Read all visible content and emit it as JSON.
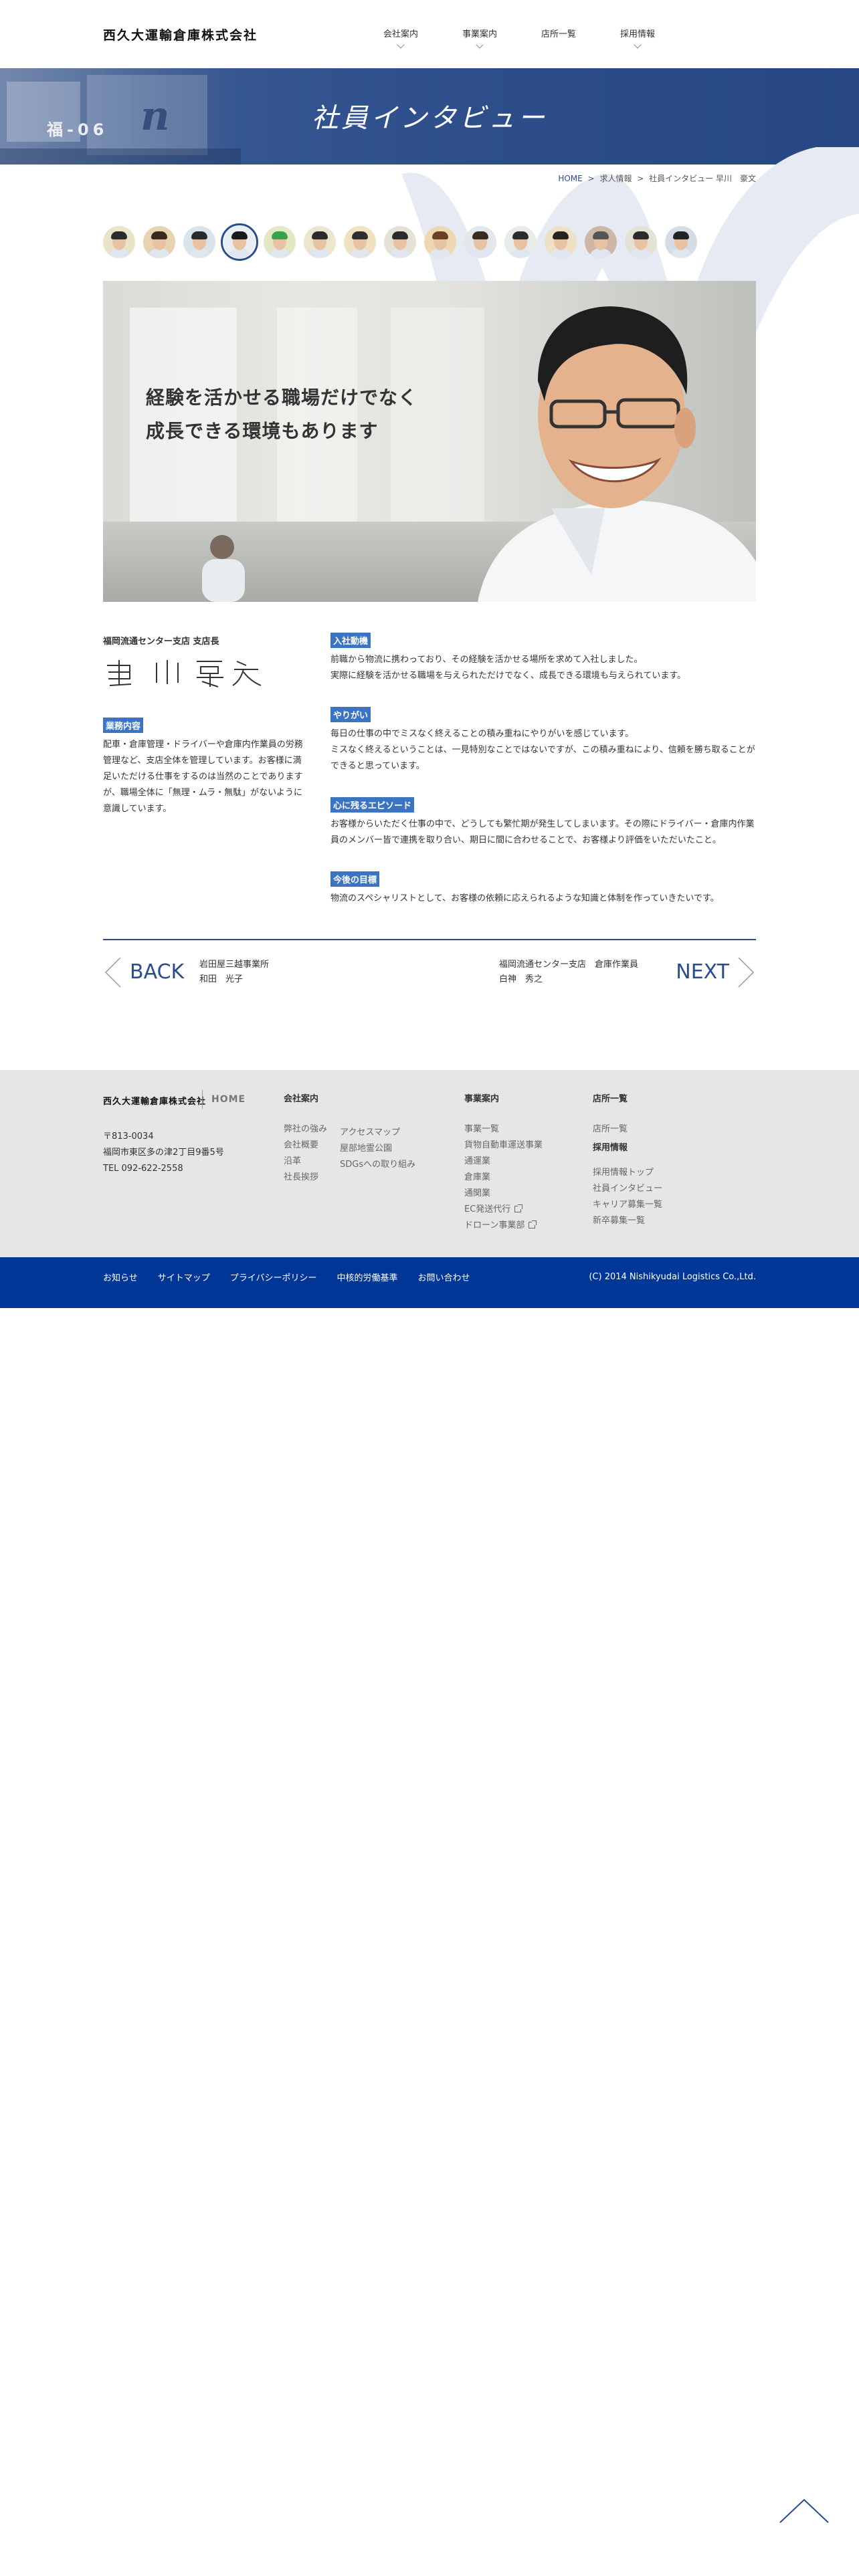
{
  "header": {
    "logo": "西久大運輸倉庫株式会社",
    "nav": [
      "会社案内",
      "事業案内",
      "店所一覧",
      "採用情報"
    ]
  },
  "banner": {
    "title": "社員インタビュー",
    "truck_text": "福-06"
  },
  "breadcrumb": {
    "home": "HOME",
    "sep": ">",
    "level1": "求人情報",
    "current": "社員インタビュー 早川　豪文"
  },
  "avatars": {
    "count": 15,
    "active_index": 3
  },
  "hero": {
    "line1": "経験を活かせる職場だけでなく",
    "line2": "成長できる環境もあります"
  },
  "profile": {
    "role": "福岡流通センター支店 支店長",
    "biz_label": "業務内容",
    "biz_text": "配車・倉庫管理・ドライバーや倉庫内作業員の労務管理など、支店全体を管理しています。お客様に満足いただける仕事をするのは当然のことでありますが、職場全体に「無理・ムラ・無駄」がないように意識しています。"
  },
  "qa": [
    {
      "label": "入社動機",
      "text": "前職から物流に携わっており、その経験を活かせる場所を求めて入社しました。\n実際に経験を活かせる職場を与えられただけでなく、成長できる環境も与えられています。"
    },
    {
      "label": "やりがい",
      "text": "毎日の仕事の中でミスなく終えることの積み重ねにやりがいを感じています。\nミスなく終えるということは、一見特別なことではないですが、この積み重ねにより、信頼を勝ち取ることができると思っています。"
    },
    {
      "label": "心に残るエピソード",
      "text": "お客様からいただく仕事の中で、どうしても繁忙期が発生してしまいます。その際にドライバー・倉庫内作業員のメンバー皆で連携を取り合い、期日に間に合わせることで、お客様より評価をいただいたこと。"
    },
    {
      "label": "今後の目標",
      "text": "物流のスペシャリストとして、お客様の依頼に応えられるような知識と体制を作っていきたいです。"
    }
  ],
  "pager": {
    "back_label": "BACK",
    "back_place": "岩田屋三越事業所",
    "back_name": "和田　光子",
    "next_label": "NEXT",
    "next_place": "福岡流通センター支店　倉庫作業員",
    "next_name": "白神　秀之"
  },
  "footer": {
    "logo": "西久大運輸倉庫株式会社",
    "home": "HOME",
    "postal": "〒813-0034",
    "address": "福岡市東区多の津2丁目9番5号",
    "tel": "TEL 092-622-2558",
    "company": {
      "head": "会社案内",
      "col1": [
        "弊社の強み",
        "会社概要",
        "沿革",
        "社長挨拶"
      ],
      "col2": [
        "アクセスマップ",
        "屋部地霊公園",
        "SDGsへの取り組み"
      ]
    },
    "business": {
      "head": "事業案内",
      "links": [
        "事業一覧",
        "貨物自動車運送事業",
        "通運業",
        "倉庫業",
        "通関業",
        "EC発送代行",
        "ドローン事業部"
      ]
    },
    "offices": {
      "head": "店所一覧",
      "links": [
        "店所一覧"
      ],
      "recruit_head": "採用情報",
      "recruit_links": [
        "採用情報トップ",
        "社員インタビュー",
        "キャリア募集一覧",
        "新卒募集一覧"
      ]
    }
  },
  "bottombar": {
    "links": [
      "お知らせ",
      "サイトマップ",
      "プライバシーポリシー",
      "中核的労働基準",
      "お問い合わせ"
    ],
    "copyright": "(C) 2014 Nishikyudai Logistics Co.,Ltd."
  },
  "colors": {
    "primary": "#2a4c8e",
    "footer_bar": "#003796",
    "label": "#3b74c2"
  },
  "icons": [
    "chevron-down-icon",
    "back-arrow-icon",
    "next-arrow-icon",
    "external-link-icon",
    "page-top-icon"
  ]
}
